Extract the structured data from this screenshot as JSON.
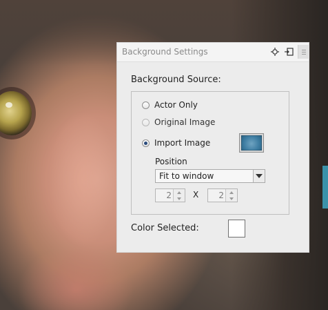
{
  "panel": {
    "title": "Background Settings",
    "icons": {
      "pin": "pin-icon",
      "dock": "dock-icon",
      "menu": "menu-icon"
    }
  },
  "background_source": {
    "label": "Background Source:",
    "options": [
      {
        "label": "Actor Only",
        "checked": false,
        "disabled": false
      },
      {
        "label": "Original Image",
        "checked": false,
        "disabled": true
      },
      {
        "label": "Import Image",
        "checked": true,
        "disabled": false
      }
    ],
    "import_thumbnail": {
      "color": "#3f7ea3"
    }
  },
  "position": {
    "label": "Position",
    "selected": "Fit to window"
  },
  "tiling": {
    "x_label": "X",
    "columns": "2",
    "rows": "2"
  },
  "color": {
    "label": "Color Selected:",
    "value": "#ffffff"
  }
}
